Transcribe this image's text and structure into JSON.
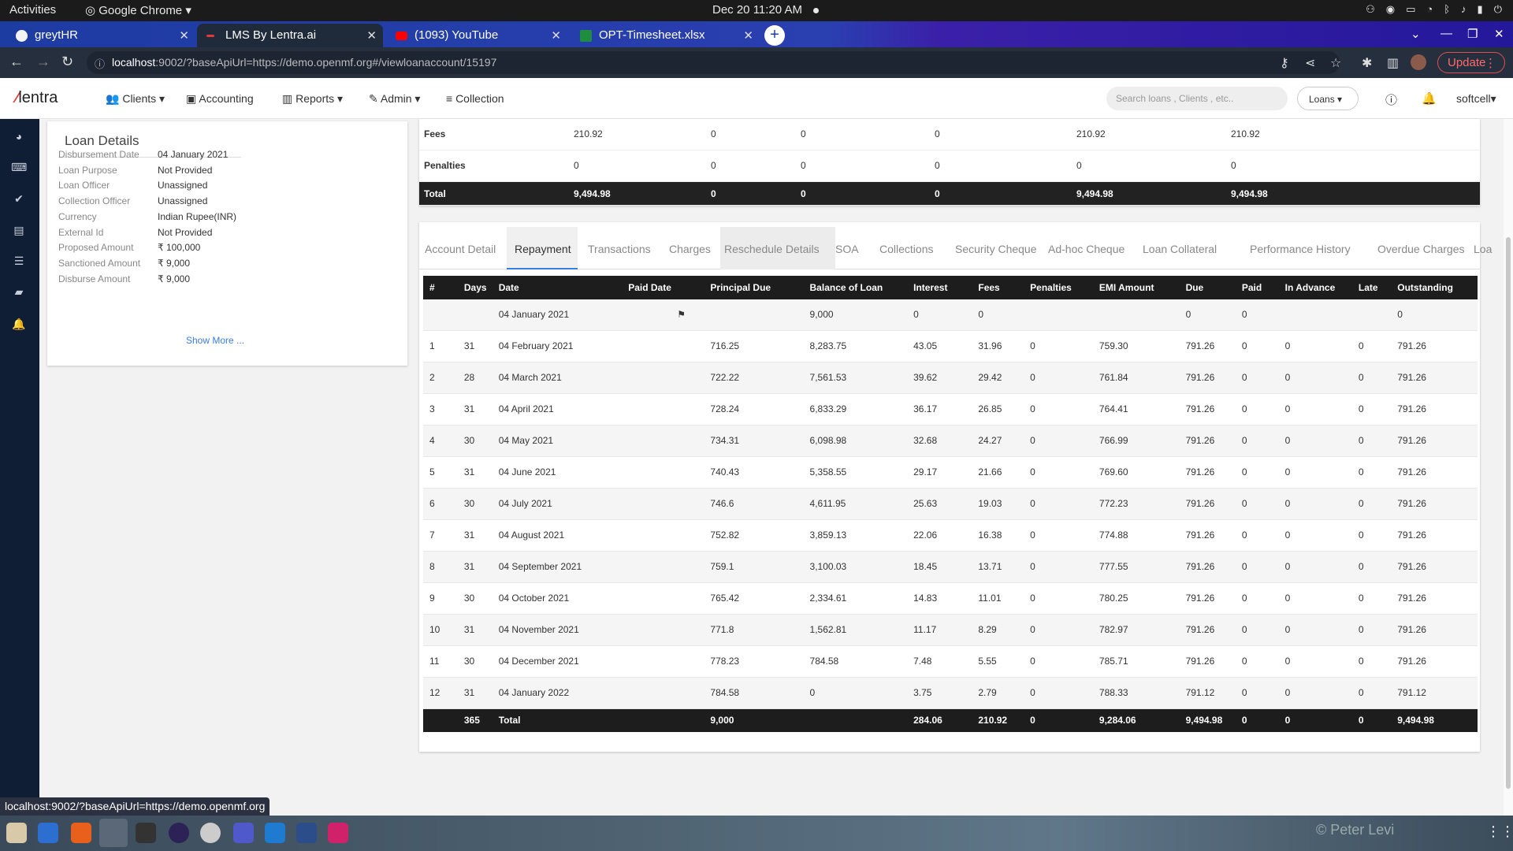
{
  "os": {
    "activities": "Activities",
    "app_name": "Google Chrome ▾",
    "clock": "Dec 20  11:20 AM"
  },
  "browser": {
    "tabs": [
      {
        "label": "greytHR",
        "color": "#f4f4f4"
      },
      {
        "label": "LMS By Lentra.ai",
        "color": "#e53935"
      },
      {
        "label": "(1093) YouTube",
        "color": "#ff0000"
      },
      {
        "label": "OPT-Timesheet.xlsx",
        "color": "#1e8e3e"
      }
    ],
    "url_host": "localhost",
    "url_rest": ":9002/?baseApiUrl=https://demo.openmf.org#/viewloanaccount/15197",
    "update_label": "Update",
    "status_url": "localhost:9002/?baseApiUrl=https://demo.openmf.org"
  },
  "header": {
    "logo": "lentra",
    "nav": [
      "Clients",
      "Accounting",
      "Reports",
      "Admin",
      "Collection"
    ],
    "search_placeholder": "Search loans , Clients , etc..",
    "loans_dropdown": "Loans",
    "user": "softcell"
  },
  "loan_details": {
    "title": "Loan Details",
    "rows": [
      {
        "k": "Disbursement Date",
        "v": "04 January 2021"
      },
      {
        "k": "Loan Purpose",
        "v": "Not Provided"
      },
      {
        "k": "Loan Officer",
        "v": "Unassigned"
      },
      {
        "k": "Collection Officer",
        "v": "Unassigned"
      },
      {
        "k": "Currency",
        "v": "Indian Rupee(INR)"
      },
      {
        "k": "External Id",
        "v": "Not Provided"
      },
      {
        "k": "Proposed Amount",
        "v": "₹ 100,000"
      },
      {
        "k": "Sanctioned Amount",
        "v": "₹ 9,000"
      },
      {
        "k": "Disburse Amount",
        "v": "₹ 9,000"
      }
    ],
    "show_more": "Show More ..."
  },
  "summary": {
    "rows": [
      {
        "label": "Fees",
        "vals": [
          "210.92",
          "0",
          "0",
          "0",
          "210.92",
          "210.92"
        ]
      },
      {
        "label": "Penalties",
        "vals": [
          "0",
          "0",
          "0",
          "0",
          "0",
          "0"
        ]
      },
      {
        "label": "Total",
        "vals": [
          "9,494.98",
          "0",
          "0",
          "0",
          "9,494.98",
          "9,494.98"
        ]
      }
    ]
  },
  "tabs": [
    "Account Detail",
    "Repayment",
    "Transactions",
    "Charges",
    "Reschedule Details",
    "SOA",
    "Collections",
    "Security Cheque",
    "Ad-hoc Cheque",
    "Loan Collateral",
    "Performance History",
    "Overdue Charges",
    "Loa"
  ],
  "schedule": {
    "headers": [
      "#",
      "Days",
      "Date",
      "Paid Date",
      "Principal Due",
      "Balance of Loan",
      "Interest",
      "Fees",
      "Penalties",
      "EMI Amount",
      "Due",
      "Paid",
      "In Advance",
      "Late",
      "Outstanding"
    ],
    "rows": [
      [
        "",
        "",
        "04 January 2021",
        "⚑",
        "",
        "9,000",
        "0",
        "0",
        "",
        "",
        "0",
        "0",
        "",
        "",
        "0"
      ],
      [
        "1",
        "31",
        "04 February 2021",
        "",
        "716.25",
        "8,283.75",
        "43.05",
        "31.96",
        "0",
        "759.30",
        "791.26",
        "0",
        "0",
        "0",
        "791.26"
      ],
      [
        "2",
        "28",
        "04 March 2021",
        "",
        "722.22",
        "7,561.53",
        "39.62",
        "29.42",
        "0",
        "761.84",
        "791.26",
        "0",
        "0",
        "0",
        "791.26"
      ],
      [
        "3",
        "31",
        "04 April 2021",
        "",
        "728.24",
        "6,833.29",
        "36.17",
        "26.85",
        "0",
        "764.41",
        "791.26",
        "0",
        "0",
        "0",
        "791.26"
      ],
      [
        "4",
        "30",
        "04 May 2021",
        "",
        "734.31",
        "6,098.98",
        "32.68",
        "24.27",
        "0",
        "766.99",
        "791.26",
        "0",
        "0",
        "0",
        "791.26"
      ],
      [
        "5",
        "31",
        "04 June 2021",
        "",
        "740.43",
        "5,358.55",
        "29.17",
        "21.66",
        "0",
        "769.60",
        "791.26",
        "0",
        "0",
        "0",
        "791.26"
      ],
      [
        "6",
        "30",
        "04 July 2021",
        "",
        "746.6",
        "4,611.95",
        "25.63",
        "19.03",
        "0",
        "772.23",
        "791.26",
        "0",
        "0",
        "0",
        "791.26"
      ],
      [
        "7",
        "31",
        "04 August 2021",
        "",
        "752.82",
        "3,859.13",
        "22.06",
        "16.38",
        "0",
        "774.88",
        "791.26",
        "0",
        "0",
        "0",
        "791.26"
      ],
      [
        "8",
        "31",
        "04 September 2021",
        "",
        "759.1",
        "3,100.03",
        "18.45",
        "13.71",
        "0",
        "777.55",
        "791.26",
        "0",
        "0",
        "0",
        "791.26"
      ],
      [
        "9",
        "30",
        "04 October 2021",
        "",
        "765.42",
        "2,334.61",
        "14.83",
        "11.01",
        "0",
        "780.25",
        "791.26",
        "0",
        "0",
        "0",
        "791.26"
      ],
      [
        "10",
        "31",
        "04 November 2021",
        "",
        "771.8",
        "1,562.81",
        "11.17",
        "8.29",
        "0",
        "782.97",
        "791.26",
        "0",
        "0",
        "0",
        "791.26"
      ],
      [
        "11",
        "30",
        "04 December 2021",
        "",
        "778.23",
        "784.58",
        "7.48",
        "5.55",
        "0",
        "785.71",
        "791.26",
        "0",
        "0",
        "0",
        "791.26"
      ],
      [
        "12",
        "31",
        "04 January 2022",
        "",
        "784.58",
        "0",
        "3.75",
        "2.79",
        "0",
        "788.33",
        "791.12",
        "0",
        "0",
        "0",
        "791.12"
      ]
    ],
    "total": [
      "",
      "365",
      "Total",
      "",
      "9,000",
      "",
      "284.06",
      "210.92",
      "0",
      "9,284.06",
      "9,494.98",
      "0",
      "0",
      "0",
      "9,494.98"
    ]
  },
  "dock": {
    "watermark": "© Peter Levi"
  }
}
